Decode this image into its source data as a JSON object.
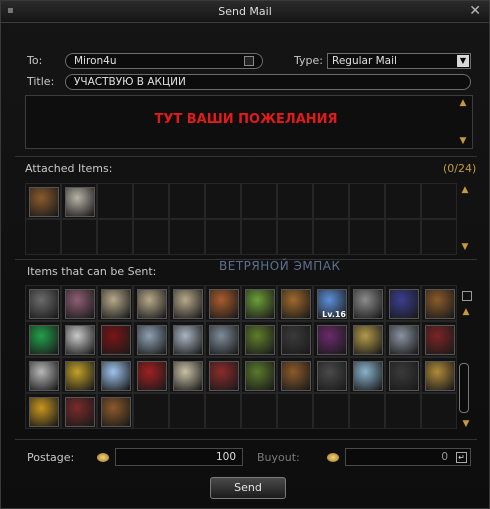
{
  "window": {
    "title": "Send Mail",
    "close_glyph": "✕"
  },
  "form": {
    "to_label": "To:",
    "to_value": "Miron4u",
    "type_label": "Type:",
    "type_value": "Regular Mail",
    "title_label": "Title:",
    "title_value": "УЧАСТВУЮ В АКЦИИ",
    "message_text": "ТУТ ВАШИ ПОЖЕЛАНИЯ"
  },
  "attached": {
    "label": "Attached Items:",
    "count": "(0/24)",
    "items": [
      {
        "icon": "boar-head-icon",
        "color": "#8a5a2b"
      },
      {
        "icon": "bone-icon",
        "color": "#b9b3a8"
      }
    ]
  },
  "sendable": {
    "label": "Items that can be Sent:",
    "watermark": "ВЕТРЯНОЙ ЭМПАК",
    "level_badge": "Lv.16",
    "items": [
      {
        "icon": "ore-chunk-icon",
        "color": "#6b6b6b"
      },
      {
        "icon": "scroll-icon",
        "color": "#8f5e74"
      },
      {
        "icon": "parchment-icon",
        "color": "#b7a98a"
      },
      {
        "icon": "parchment-icon",
        "color": "#b7a98a"
      },
      {
        "icon": "parchment-icon",
        "color": "#b7a98a"
      },
      {
        "icon": "scroll-icon",
        "color": "#a85c2d"
      },
      {
        "icon": "scroll-icon",
        "color": "#6c9e38"
      },
      {
        "icon": "scroll-icon",
        "color": "#9f6a2c"
      },
      {
        "icon": "crystal-icon",
        "color": "#5d8fd8"
      },
      {
        "icon": "tombstone-icon",
        "color": "#8c8c8c"
      },
      {
        "icon": "potion-bowl-icon",
        "color": "#3b3e8f"
      },
      {
        "icon": "wooden-box-icon",
        "color": "#8a5a2b"
      },
      {
        "icon": "green-orb-icon",
        "color": "#22a04a"
      },
      {
        "icon": "silver-orb-icon",
        "color": "#c9c9c9"
      },
      {
        "icon": "red-book-icon",
        "color": "#7a1515"
      },
      {
        "icon": "crystal-cluster-icon",
        "color": "#8fa1b3"
      },
      {
        "icon": "crystal-cluster-icon",
        "color": "#a9b4c2"
      },
      {
        "icon": "crystal-cluster-icon",
        "color": "#7e8c99"
      },
      {
        "icon": "green-pouch-icon",
        "color": "#5f7d2a"
      },
      {
        "icon": "dark-scroll-icon",
        "color": "#3a3a3a"
      },
      {
        "icon": "purple-gem-icon",
        "color": "#6a2a6a"
      },
      {
        "icon": "hay-bundle-icon",
        "color": "#b39a4a"
      },
      {
        "icon": "crystal-cluster-icon",
        "color": "#8a93a0"
      },
      {
        "icon": "crystal-cluster-icon",
        "color": "#7c2424"
      },
      {
        "icon": "stone-block-icon",
        "color": "#b8b8b8"
      },
      {
        "icon": "yellow-vial-icon",
        "color": "#c2a12a"
      },
      {
        "icon": "blue-crystal-icon",
        "color": "#9fc4ef"
      },
      {
        "icon": "red-potion-icon",
        "color": "#a02020"
      },
      {
        "icon": "scroll-roll-icon",
        "color": "#c9c0a6"
      },
      {
        "icon": "scroll-icon",
        "color": "#8c2b2b"
      },
      {
        "icon": "scroll-icon",
        "color": "#5a7a2b"
      },
      {
        "icon": "scroll-icon",
        "color": "#8c5a2b"
      },
      {
        "icon": "black-ore-icon",
        "color": "#4a4a4a"
      },
      {
        "icon": "crystal-shard-icon",
        "color": "#8ab3cc"
      },
      {
        "icon": "black-ore-icon",
        "color": "#3a3a3a"
      },
      {
        "icon": "gold-ore-icon",
        "color": "#b08a3a"
      },
      {
        "icon": "eye-coin-icon",
        "color": "#c8961e"
      },
      {
        "icon": "crystal-cluster-icon",
        "color": "#7a2a2a"
      },
      {
        "icon": "boar-head-icon",
        "color": "#8a5a2b"
      }
    ],
    "total_cells": 48
  },
  "postage": {
    "label": "Postage:",
    "value": "100"
  },
  "buyout": {
    "label": "Buyout:",
    "value": "0"
  },
  "send_label": "Send"
}
